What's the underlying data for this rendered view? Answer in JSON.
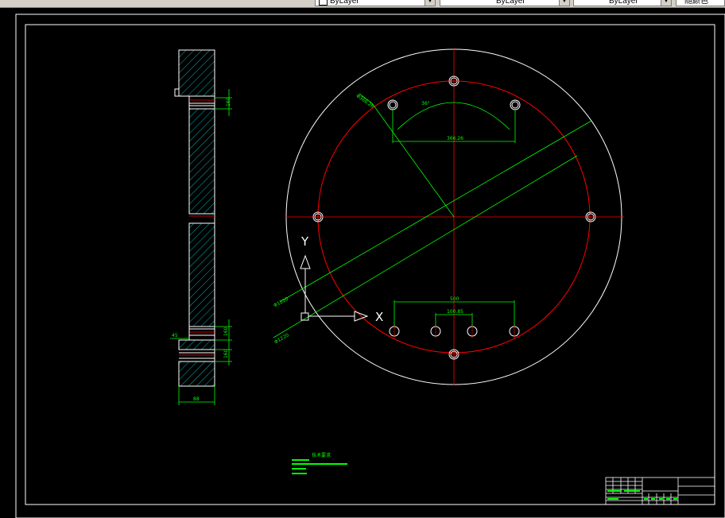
{
  "toolbar": {
    "color_combo": "ByLayer",
    "linetype_combo": "ByLayer",
    "lineweight_combo": "ByLayer",
    "plotstyle_combo": "随颜色"
  },
  "ucs": {
    "x_label": "X",
    "y_label": "Y"
  },
  "section_view": {
    "dim_thickness": "88",
    "dim_left": "45",
    "dim_upper": "160",
    "dim_lower_a": "160",
    "dim_lower_b": "160"
  },
  "plan_view": {
    "dim_pcd_top": "Φ366.26",
    "dim_angle": "36°",
    "dim_chord_top": "366.26",
    "dim_chord_bottom_outer": "500",
    "dim_chord_bottom_inner": "100.85",
    "dim_dia_a": "Φ1220",
    "dim_dia_b": "Φ1220"
  },
  "notes": {
    "title": "技术要求",
    "lines": [
      "1. 未注倒角",
      "2. 锐边倒钝处理",
      "3.",
      "4."
    ]
  },
  "title_block": {
    "label": ""
  },
  "colors": {
    "background": "#000000",
    "outline": "#ffffff",
    "center_line": "#ff0000",
    "dimension": "#00ff00",
    "hatch": "#00e0e0"
  }
}
